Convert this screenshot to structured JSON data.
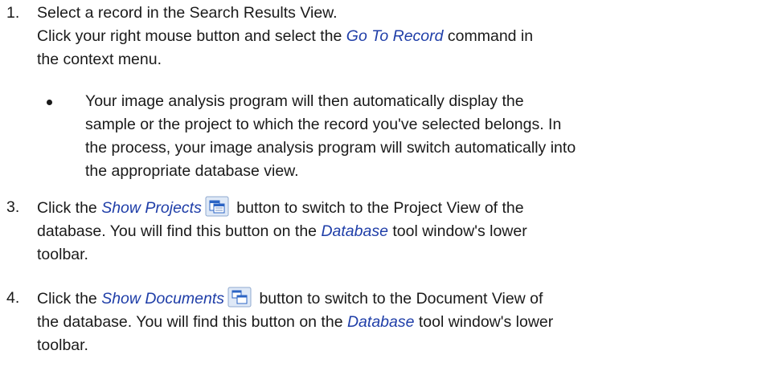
{
  "step1": {
    "number": "1.",
    "line1": "Select a record in the Search Results View.",
    "line2_before": "Click your right mouse button and select the ",
    "line2_link": "Go To Record",
    "line2_after": " command in",
    "line3": "the context menu."
  },
  "bullet": {
    "line1": "Your image analysis program will then automatically display the",
    "line2": "sample or the project to which the record you've selected belongs. In",
    "line3": "the process, your image analysis program will switch automatically into",
    "line4": "the appropriate database view."
  },
  "step3": {
    "number": "3.",
    "line1_before": "Click the ",
    "line1_link": "Show Projects",
    "line1_after": " button to switch to the Project View of the",
    "line2_before": "database. You will find this button on the ",
    "line2_link": "Database",
    "line2_after": " tool window's lower",
    "line3": "toolbar.",
    "icon": "show-projects-icon"
  },
  "step4": {
    "number": "4.",
    "line1_before": "Click the ",
    "line1_link": "Show Documents",
    "line1_after": " button to switch to the Document View of",
    "line2_before": "the database. You will find this button on the ",
    "line2_link": "Database",
    "line2_after": " tool window's lower",
    "line3": "toolbar.",
    "icon": "show-documents-icon"
  },
  "colors": {
    "link": "#1f3ea8",
    "text": "#1a1a1a"
  }
}
